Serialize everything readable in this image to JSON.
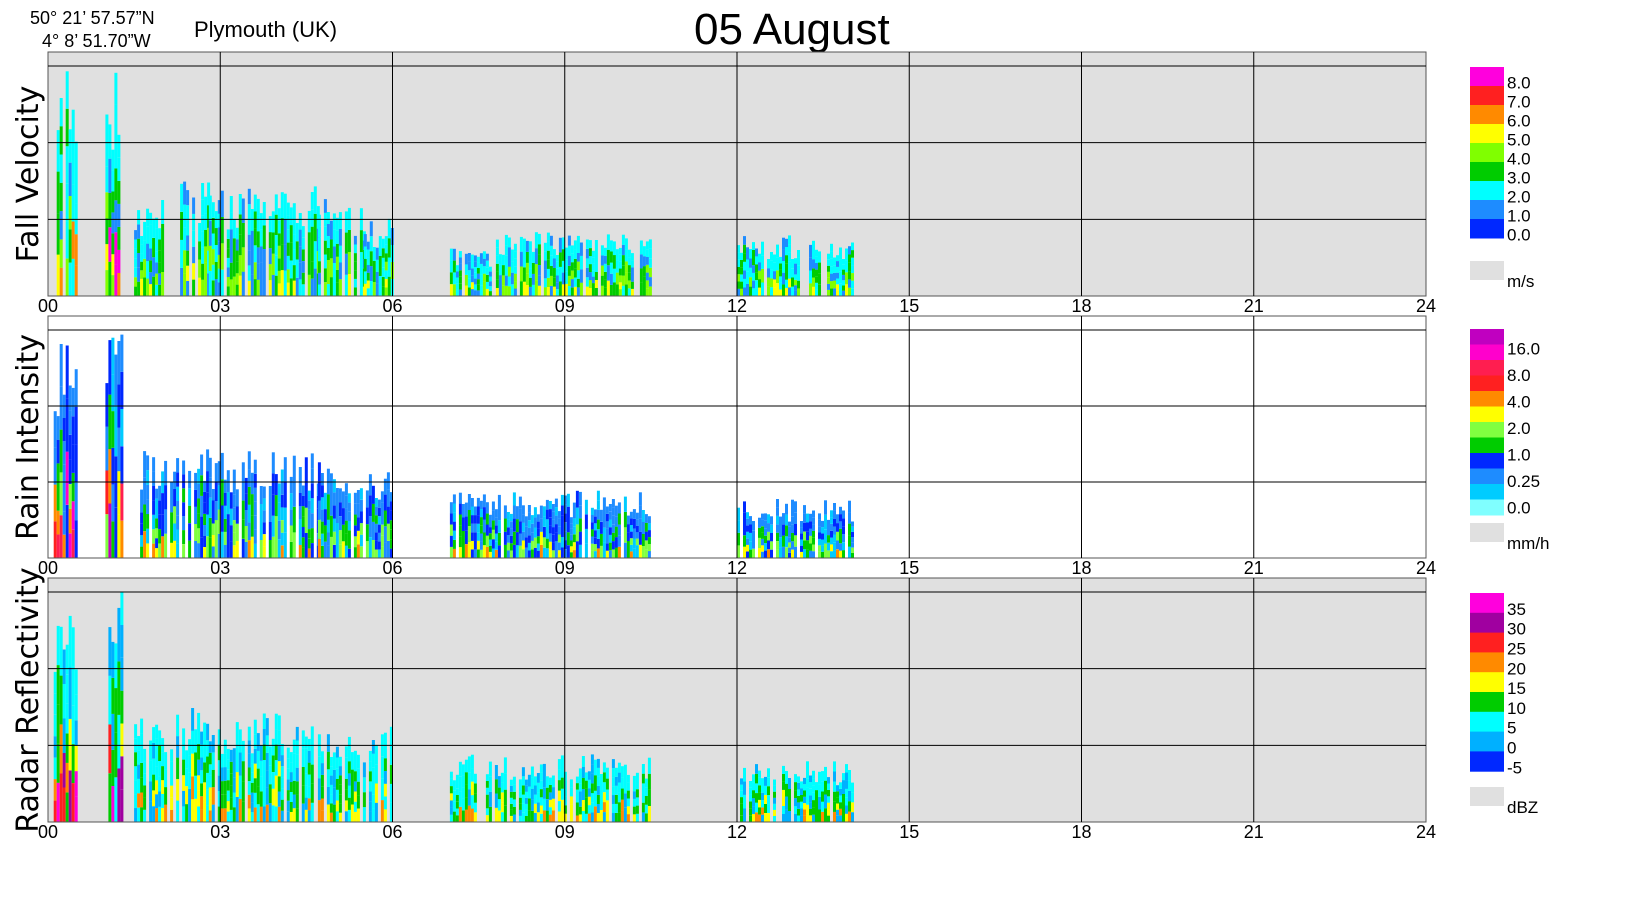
{
  "header": {
    "lat": "50° 21’ 57.57”N",
    "lon": "4°  8’ 51.70”W",
    "location": "Plymouth (UK)",
    "title": "05 August"
  },
  "chart_data": [
    {
      "type": "heatmap",
      "ylabel": "Fall Velocity",
      "x_ticks": [
        "00",
        "03",
        "06",
        "09",
        "12",
        "15",
        "18",
        "21",
        "24"
      ],
      "xlim": [
        0,
        24
      ],
      "background": "#e0e0e0",
      "unit": "m/s",
      "colorbar": {
        "labels": [
          "8.0",
          "7.0",
          "6.0",
          "5.0",
          "4.0",
          "3.0",
          "2.0",
          "1.0",
          "0.0"
        ],
        "colors": [
          "#ff00dd",
          "#ff2020",
          "#ff8a00",
          "#ffff00",
          "#80ff00",
          "#00cc00",
          "#00ffff",
          "#1e8cff",
          "#0028ff"
        ]
      },
      "echo_episodes": [
        {
          "start": 0.1,
          "end": 0.5,
          "top": 0.95
        },
        {
          "start": 1.0,
          "end": 1.3,
          "top": 0.95
        },
        {
          "start": 1.5,
          "end": 2.3,
          "top": 0.4
        },
        {
          "start": 2.3,
          "end": 2.8,
          "top": 0.47
        },
        {
          "start": 2.8,
          "end": 4.7,
          "top": 0.45
        },
        {
          "start": 4.7,
          "end": 5.5,
          "top": 0.4
        },
        {
          "start": 5.5,
          "end": 6.0,
          "top": 0.33
        },
        {
          "start": 7.0,
          "end": 7.8,
          "top": 0.2
        },
        {
          "start": 7.8,
          "end": 10.5,
          "top": 0.28
        },
        {
          "start": 12.0,
          "end": 14.0,
          "top": 0.25
        }
      ]
    },
    {
      "type": "heatmap",
      "ylabel": "Rain Intensity",
      "x_ticks": [
        "00",
        "03",
        "06",
        "09",
        "12",
        "15",
        "18",
        "21",
        "24"
      ],
      "xlim": [
        0,
        24
      ],
      "background": "#ffffff",
      "unit": "mm/h",
      "colorbar": {
        "labels": [
          "16.0",
          "8.0",
          "4.0",
          "2.0",
          "1.0",
          "0.25",
          "0.0"
        ],
        "colors": [
          "#c000c0",
          "#ff00cc",
          "#ff1e50",
          "#ff2020",
          "#ff8a00",
          "#ffff00",
          "#80ff40",
          "#00cc00",
          "#0028ff",
          "#1e8cff",
          "#00ccff",
          "#80ffff"
        ]
      },
      "echo_episodes": [
        {
          "start": 0.1,
          "end": 0.5,
          "top": 0.95
        },
        {
          "start": 1.0,
          "end": 1.3,
          "top": 0.95
        },
        {
          "start": 1.5,
          "end": 2.8,
          "top": 0.47
        },
        {
          "start": 2.8,
          "end": 4.7,
          "top": 0.45
        },
        {
          "start": 4.7,
          "end": 6.0,
          "top": 0.4
        },
        {
          "start": 7.0,
          "end": 10.5,
          "top": 0.28
        },
        {
          "start": 12.0,
          "end": 14.0,
          "top": 0.25
        }
      ]
    },
    {
      "type": "heatmap",
      "ylabel": "Radar Reflectivity",
      "x_ticks": [
        "00",
        "03",
        "06",
        "09",
        "12",
        "15",
        "18",
        "21",
        "24"
      ],
      "xlim": [
        0,
        24
      ],
      "background": "#e0e0e0",
      "unit": "dBZ",
      "colorbar": {
        "labels": [
          "35",
          "30",
          "25",
          "20",
          "15",
          "10",
          "5",
          "0",
          "-5"
        ],
        "colors": [
          "#ff00dd",
          "#a000a0",
          "#ff2020",
          "#ff8a00",
          "#ffff00",
          "#00cc00",
          "#00ffff",
          "#00b0ff",
          "#0028ff"
        ]
      },
      "echo_episodes": [
        {
          "start": 0.1,
          "end": 0.5,
          "top": 0.95
        },
        {
          "start": 1.0,
          "end": 1.3,
          "top": 0.95
        },
        {
          "start": 1.5,
          "end": 2.8,
          "top": 0.47
        },
        {
          "start": 2.8,
          "end": 4.7,
          "top": 0.45
        },
        {
          "start": 4.7,
          "end": 6.0,
          "top": 0.4
        },
        {
          "start": 7.0,
          "end": 10.5,
          "top": 0.28
        },
        {
          "start": 12.0,
          "end": 14.0,
          "top": 0.25
        }
      ]
    }
  ]
}
